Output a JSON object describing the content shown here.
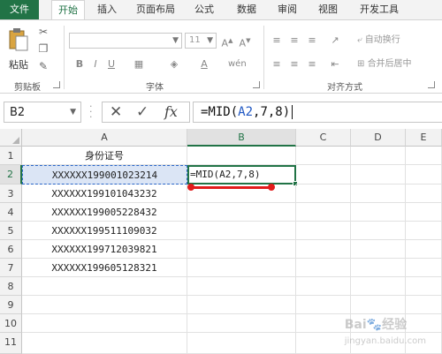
{
  "tabs": [
    {
      "label": "文件"
    },
    {
      "label": "开始"
    },
    {
      "label": "插入"
    },
    {
      "label": "页面布局"
    },
    {
      "label": "公式"
    },
    {
      "label": "数据"
    },
    {
      "label": "审阅"
    },
    {
      "label": "视图"
    },
    {
      "label": "开发工具"
    }
  ],
  "colors": {
    "excel_green": "#217346",
    "selection_blue": "#2a66c8",
    "annotation_red": "#e21b1b"
  },
  "ribbon": {
    "groups": {
      "clipboard": "剪贴板",
      "font": "字体",
      "alignment": "对齐方式"
    },
    "paste_label": "粘贴",
    "font_size": "11",
    "wrap_text": "自动换行",
    "merge_center": "合并后居中",
    "icons": [
      "cut-icon",
      "copy-icon",
      "format-painter-icon",
      "bold-icon",
      "italic-icon",
      "underline-icon",
      "border-icon",
      "fill-color-icon",
      "font-color-icon",
      "grow-font-icon",
      "shrink-font-icon",
      "wen-icon",
      "align-top-icon",
      "align-middle-icon",
      "align-bottom-icon",
      "orientation-icon",
      "align-left-icon",
      "align-center-icon",
      "align-right-icon",
      "indent-icon"
    ]
  },
  "formula_bar": {
    "name_box": "B2",
    "cancel_symbol": "✕",
    "enter_symbol": "✓",
    "fx_symbol": "fx",
    "formula_prefix": "=MID(",
    "formula_ref": "A2",
    "formula_suffix": ",7,8)"
  },
  "sheet": {
    "columns": [
      "A",
      "B",
      "C",
      "D",
      "E"
    ],
    "rows": [
      "1",
      "2",
      "3",
      "4",
      "5",
      "6",
      "7",
      "8",
      "9",
      "10",
      "11"
    ],
    "header": "身份证号",
    "ids": [
      "XXXXXX199001023214",
      "XXXXXX199101043232",
      "XXXXXX199005228432",
      "XXXXXX199511109032",
      "XXXXXX199712039821",
      "XXXXXX199605128321"
    ],
    "b2_content": "=MID(A2,7,8)"
  },
  "watermark": {
    "brand": "Bai",
    "suffix": "经验",
    "url": "jingyan.baidu.com"
  }
}
